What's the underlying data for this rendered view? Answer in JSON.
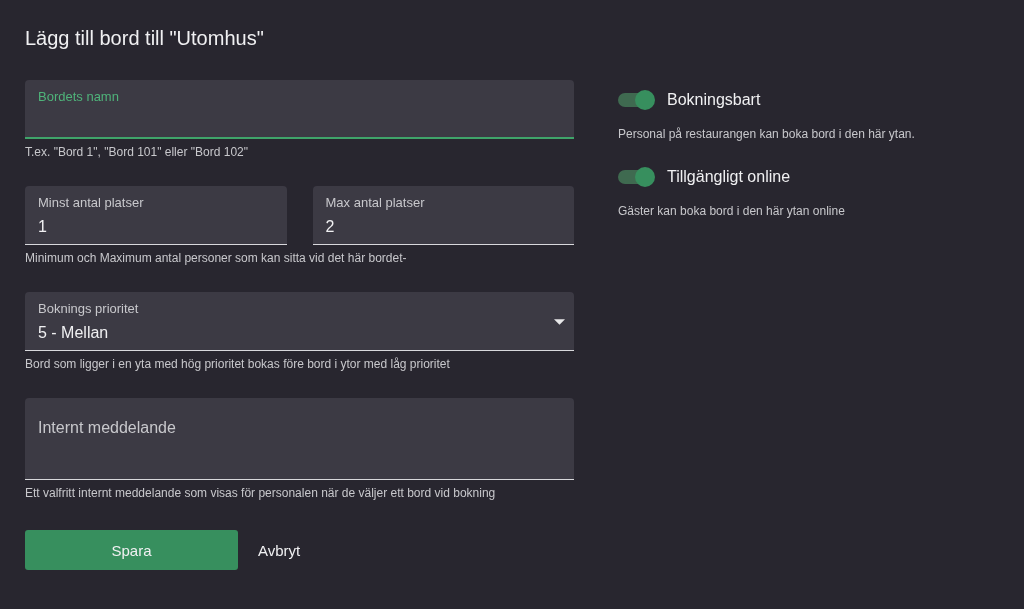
{
  "title": "Lägg till bord till \"Utomhus\"",
  "fields": [
    {
      "kind": "text",
      "items": [
        {
          "label": "Bordets namn",
          "value": "",
          "focused": true
        }
      ],
      "helper": "T.ex. \"Bord 1\", \"Bord 101\" eller \"Bord 102\""
    },
    {
      "kind": "pair",
      "items": [
        {
          "label": "Minst antal platser",
          "value": "1",
          "focused": false
        },
        {
          "label": "Max antal platser",
          "value": "2",
          "focused": false
        }
      ],
      "helper": "Minimum och Maximum antal personer som kan sitta vid det här bordet-"
    },
    {
      "kind": "select",
      "items": [
        {
          "label": "Boknings prioritet",
          "value": "5 - Mellan",
          "focused": false
        }
      ],
      "helper": "Bord som ligger i en yta med hög prioritet bokas före bord i ytor med låg prioritet"
    },
    {
      "kind": "textarea",
      "items": [
        {
          "label": "Internt meddelande",
          "value": "",
          "focused": false
        }
      ],
      "helper": "Ett valfritt internt meddelande som visas för personalen när de väljer ett bord vid bokning"
    }
  ],
  "buttons": [
    {
      "label": "Spara",
      "kind": "primary"
    },
    {
      "label": "Avbryt",
      "kind": "text"
    }
  ],
  "toggles": [
    {
      "label": "Bokningsbart",
      "on": true,
      "description": "Personal på restaurangen kan boka bord i den här ytan."
    },
    {
      "label": "Tillgängligt online",
      "on": true,
      "description": "Gäster kan boka bord i den här ytan online"
    }
  ]
}
